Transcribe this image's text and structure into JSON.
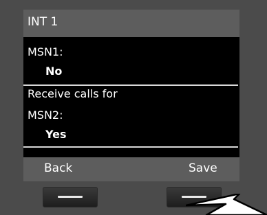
{
  "header": {
    "title": "INT 1"
  },
  "settings": {
    "msn1_label": "MSN1:",
    "msn1_value": "No",
    "receive_calls_label": "Receive calls for",
    "msn2_label": "MSN2:",
    "msn2_value": "Yes"
  },
  "softkeys": {
    "left_label": "Back",
    "right_label": "Save"
  },
  "colors": {
    "screen_background": "#000000",
    "bar_background": "#5d5d5d",
    "text": "#ffffff",
    "separator": "#d8d8d8"
  },
  "icons": {
    "pointer": "arrow-pointer-icon",
    "key_marks": "dash-icon"
  }
}
